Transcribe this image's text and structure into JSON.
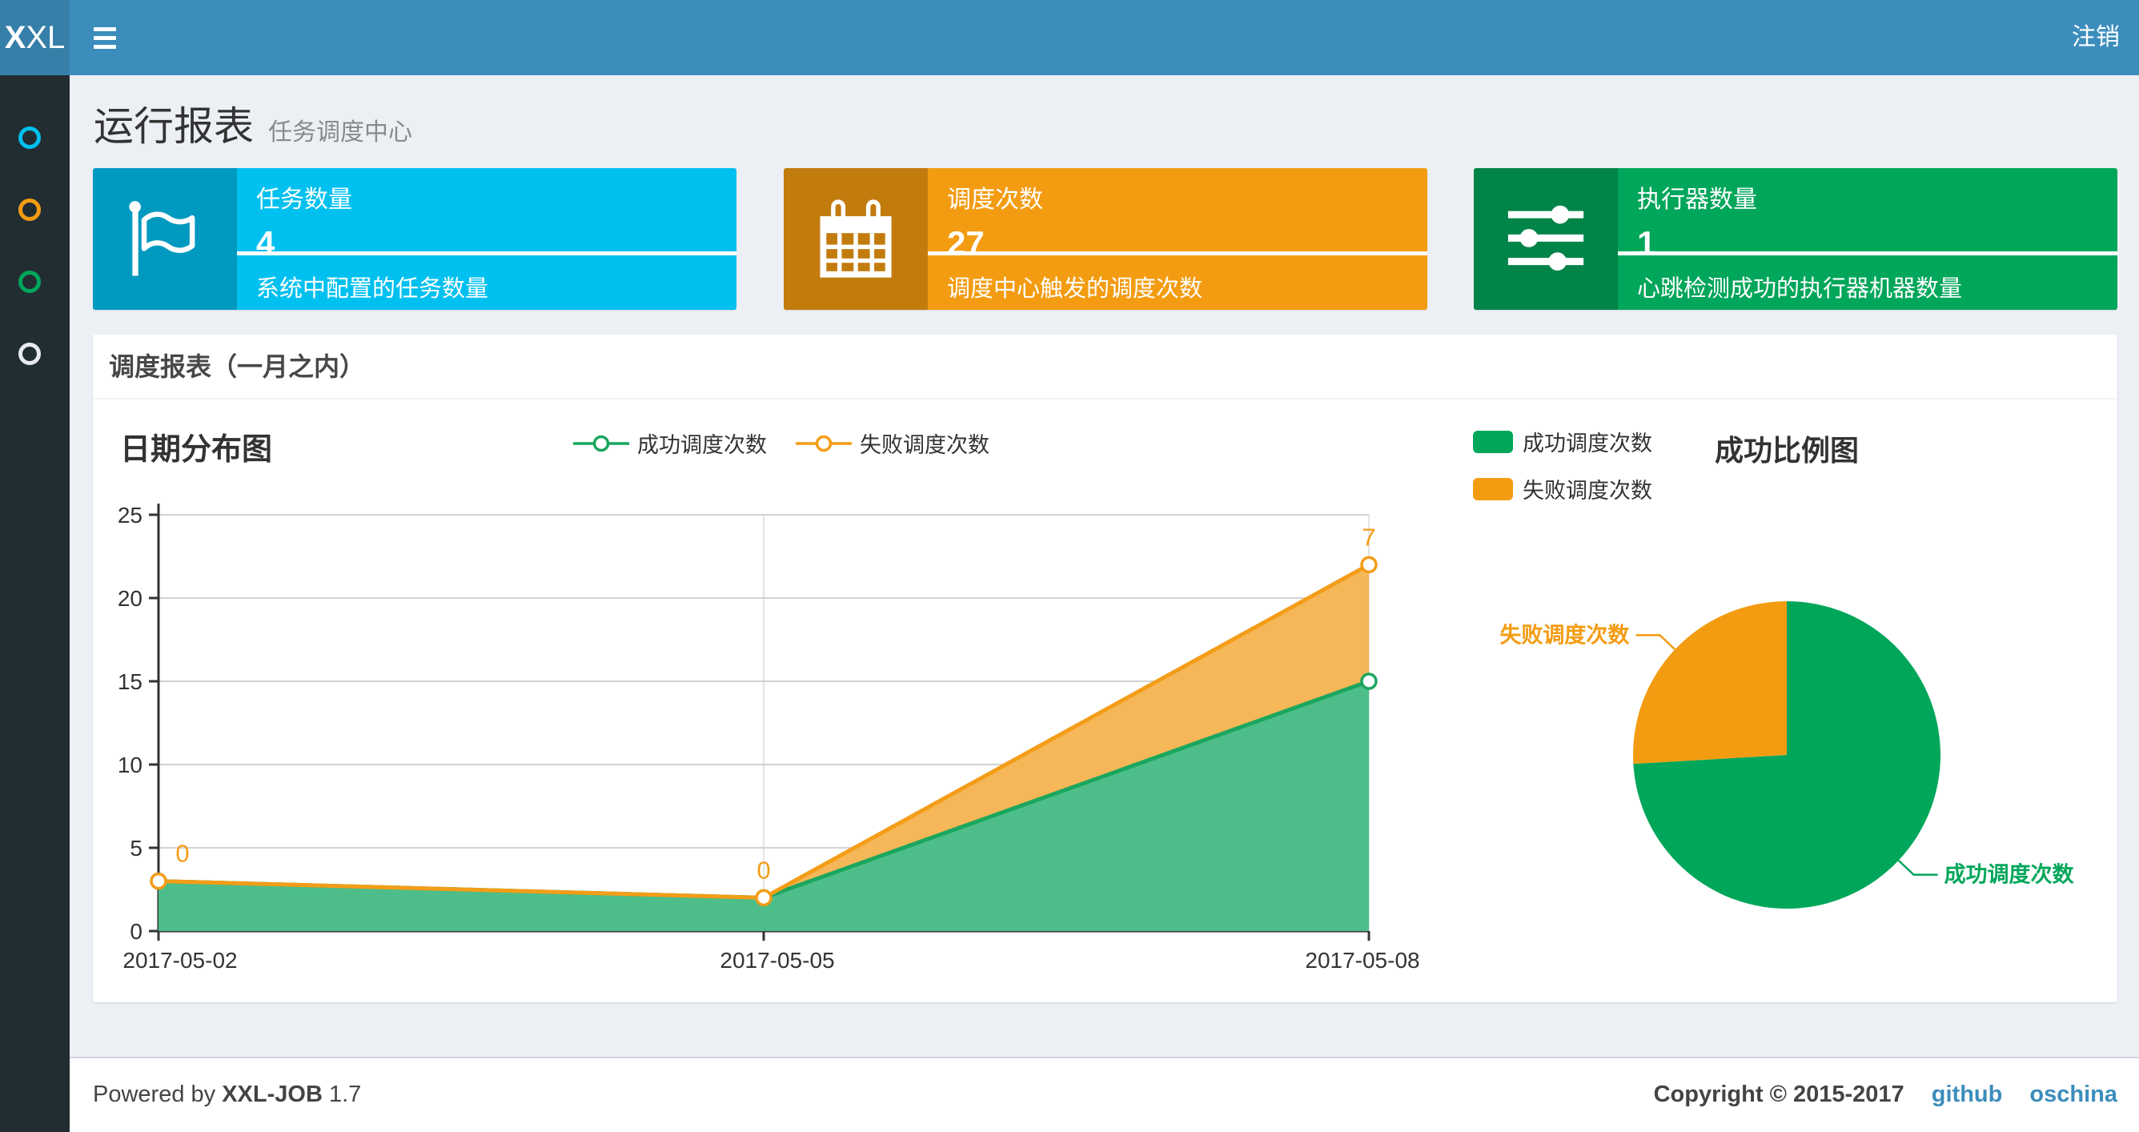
{
  "navbar": {
    "logo_bold": "X",
    "logo_light": "XL",
    "logout": "注销"
  },
  "sidebar": {
    "items": [
      {
        "icon": "circle-o-icon",
        "color": "#00c0ef"
      },
      {
        "icon": "circle-o-icon",
        "color": "#f39c12"
      },
      {
        "icon": "circle-o-icon",
        "color": "#00a65a"
      },
      {
        "icon": "circle-o-icon",
        "color": "#e7eaee"
      }
    ]
  },
  "header": {
    "title": "运行报表",
    "subtitle": "任务调度中心"
  },
  "stats": [
    {
      "title": "任务数量",
      "value": 4,
      "desc": "系统中配置的任务数量",
      "color": "#00c0ef",
      "icon": "flag-icon"
    },
    {
      "title": "调度次数",
      "value": 27,
      "desc": "调度中心触发的调度次数",
      "color": "#f39c12",
      "icon": "calendar-icon"
    },
    {
      "title": "执行器数量",
      "value": 1,
      "desc": "心跳检测成功的执行器机器数量",
      "color": "#00a65a",
      "icon": "sliders-icon"
    }
  ],
  "panel": {
    "title": "调度报表（一月之内）"
  },
  "chart_data": [
    {
      "type": "area",
      "title": "日期分布图",
      "stacked": true,
      "x": [
        "2017-05-02",
        "2017-05-05",
        "2017-05-08"
      ],
      "series": [
        {
          "name": "成功调度次数",
          "values": [
            3,
            2,
            15
          ],
          "color": "#1ba65e",
          "fill": "#4dbe89"
        },
        {
          "name": "失败调度次数",
          "values": [
            0,
            0,
            7
          ],
          "color": "#f39d18",
          "fill": "#f5b757"
        }
      ],
      "point_labels_series": "失败调度次数",
      "point_labels": [
        0,
        0,
        7
      ],
      "ylim": [
        0,
        25
      ],
      "yticks": [
        0,
        5,
        10,
        15,
        20,
        25
      ],
      "grid": true,
      "legend_position": "top-center"
    },
    {
      "type": "pie",
      "title": "成功比例图",
      "slices": [
        {
          "name": "成功调度次数",
          "value": 20,
          "color": "#00a65a"
        },
        {
          "name": "失败调度次数",
          "value": 7,
          "color": "#f39c12"
        }
      ],
      "total": 27,
      "legend_position": "top-left"
    }
  ],
  "footer": {
    "powered_by": "Powered by",
    "brand": "XXL-JOB",
    "version": "1.7",
    "copyright": "Copyright © 2015-2017",
    "links": [
      "github",
      "oschina"
    ]
  }
}
